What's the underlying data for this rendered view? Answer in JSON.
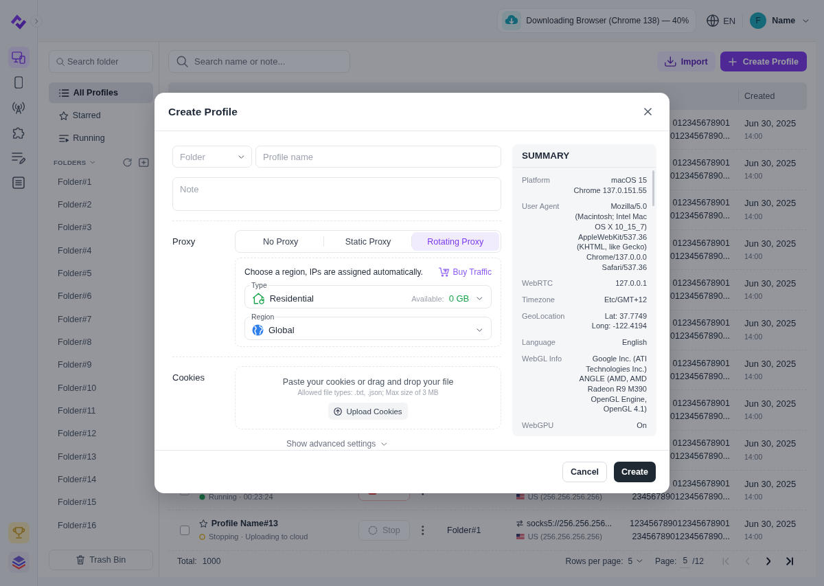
{
  "rail": {
    "items": [
      {
        "selected": true
      },
      {
        "selected": false
      },
      {
        "selected": false
      },
      {
        "selected": false
      },
      {
        "selected": false
      },
      {
        "selected": false
      }
    ]
  },
  "header": {
    "download": {
      "text": "Downloading Browser (Chrome 138) — 40%"
    },
    "language": "EN",
    "user": {
      "initial": "F",
      "name": "Name"
    }
  },
  "folder_panel": {
    "search": {
      "placeholder": "Search folder"
    },
    "views": [
      {
        "label": "All Profiles",
        "selected": true
      },
      {
        "label": "Starred",
        "selected": false
      },
      {
        "label": "Running",
        "selected": false
      }
    ],
    "folders_header": {
      "label": "FOLDERS",
      "expanded": true
    },
    "folders": [
      {
        "label": "Folder#1",
        "selected": false
      },
      {
        "label": "Folder#2",
        "selected": false
      },
      {
        "label": "Folder#3",
        "selected": false
      },
      {
        "label": "Folder#4",
        "selected": false
      },
      {
        "label": "Folder#5",
        "selected": false
      },
      {
        "label": "Folder#6",
        "selected": false
      },
      {
        "label": "Folder#7",
        "selected": false
      },
      {
        "label": "Folder#8",
        "selected": false
      },
      {
        "label": "Folder#9",
        "selected": false
      },
      {
        "label": "Folder#10",
        "selected": false
      },
      {
        "label": "Folder#11",
        "selected": false
      },
      {
        "label": "Folder#12",
        "selected": false
      },
      {
        "label": "Folder#13",
        "selected": false
      },
      {
        "label": "Folder#14",
        "selected": false
      },
      {
        "label": "Folder#15",
        "selected": false
      },
      {
        "label": "Folder#16",
        "selected": false
      }
    ],
    "trash_button": "Trash Bin"
  },
  "toolbar": {
    "search": {
      "placeholder": "Search name or note..."
    },
    "import_button": "Import",
    "create_button": "Create Profile"
  },
  "table": {
    "columns": [
      "Created"
    ],
    "rows": [
      {
        "id_lines": [
          "012345678901",
          "01234567890..."
        ],
        "date": "Jun 30, 2025",
        "time": "14:00"
      },
      {
        "id_lines": [
          "012345678901",
          "01234567890..."
        ],
        "date": "Jun 30, 2025",
        "time": "14:00"
      },
      {
        "id_lines": [
          "012345678901",
          "01234567890..."
        ],
        "date": "Jun 30, 2025",
        "time": "14:00"
      },
      {
        "id_lines": [
          "012345678901",
          "01234567890..."
        ],
        "date": "Jun 30, 2025",
        "time": "14:00"
      },
      {
        "id_lines": [
          "012345678901",
          "01234567890..."
        ],
        "date": "Jun 30, 2025",
        "time": "14:00"
      },
      {
        "id_lines": [
          "012345678901",
          "01234567890..."
        ],
        "date": "Jun 30, 2025",
        "time": "14:00"
      },
      {
        "id_lines": [
          "012345678901",
          "01234567890..."
        ],
        "date": "Jun 30, 2025",
        "time": "14:00"
      },
      {
        "id_lines": [
          "012345678901",
          "01234567890..."
        ],
        "date": "Jun 30, 2025",
        "time": "14:00"
      },
      {
        "id_lines": [
          "012345678901",
          "01234567890..."
        ],
        "date": "Jun 30, 2025",
        "time": "14:00"
      },
      {
        "checked": false,
        "status": {
          "kind": "running",
          "text": "Running · 00:23:24"
        },
        "action": {
          "disabled": false
        },
        "proxy": {
          "location": "US (256.256.256.256)"
        },
        "id_lines": [
          "012345678901",
          "2345678901234567890..."
        ],
        "date": "Jun 30, 2025",
        "time": "14:00"
      },
      {
        "checked": false,
        "starred": false,
        "name": "Profile Name#13",
        "status": {
          "kind": "stopping",
          "text": "Stopping · Uploading to cloud"
        },
        "action": {
          "label": "Stop",
          "disabled": true
        },
        "folder": "Folder#1",
        "proxy": {
          "address": "socks5://256.256.256...",
          "location": "US (256.256.256.256)"
        },
        "id_lines": [
          "123456789012345678901",
          "2345678901234567890..."
        ],
        "date": "Jun 30, 2025",
        "time": "14:00"
      }
    ],
    "footer": {
      "total_label": "Total:",
      "total": "1000",
      "rows_label": "Rows per page:",
      "rows_per_page": "5",
      "page_label": "Page:",
      "page": "5",
      "page_count": "/12",
      "pager": [
        {
          "kind": "first",
          "disabled": true
        },
        {
          "kind": "previous",
          "disabled": true
        },
        {
          "kind": "next",
          "disabled": false
        },
        {
          "kind": "last",
          "disabled": false
        }
      ]
    }
  },
  "modal": {
    "title": "Create Profile",
    "folder_select": {
      "placeholder": "Folder"
    },
    "profile_name": {
      "placeholder": "Profile name"
    },
    "note": {
      "placeholder": "Note"
    },
    "proxy": {
      "label": "Proxy",
      "tabs": [
        {
          "label": "No Proxy",
          "selected": false
        },
        {
          "label": "Static Proxy",
          "selected": false
        },
        {
          "label": "Rotating Proxy",
          "selected": true
        }
      ],
      "hint": "Choose a region, IPs are assigned automatically.",
      "buy_link": "Buy Traffic",
      "type": {
        "label": "Type",
        "value": "Residential",
        "available_label": "Available:",
        "available_value": "0 GB"
      },
      "region": {
        "label": "Region",
        "value": "Global"
      }
    },
    "cookies": {
      "label": "Cookies",
      "drop_text": "Paste your cookies or drag and drop your file",
      "allowed": "Allowed file types: .txt, .json; Max size of 3 MB",
      "upload_button": "Upload Cookies"
    },
    "advanced": {
      "label": "Show advanced settings",
      "expanded": false
    },
    "summary": {
      "title": "SUMMARY",
      "rows": [
        {
          "label": "Platform",
          "lines": [
            "macOS 15",
            "Chrome 137.0.151.55"
          ]
        },
        {
          "label": "User Agent",
          "lines": [
            "Mozilla/5.0",
            "(Macintosh; Intel Mac",
            "OS X 10_15_7)",
            "AppleWebKit/537.36",
            "(KHTML, like Gecko)",
            "Chrome/137.0.0.0",
            "Safari/537.36"
          ]
        },
        {
          "label": "WebRTC",
          "lines": [
            "127.0.0.1"
          ]
        },
        {
          "label": "Timezone",
          "lines": [
            "Etc/GMT+12"
          ]
        },
        {
          "label": "GeoLocation",
          "lines": [
            "Lat: 37.7749",
            "Long: -122.4194"
          ]
        },
        {
          "label": "Language",
          "lines": [
            "English"
          ]
        },
        {
          "label": "WebGL Info",
          "lines": [
            "Google Inc. (ATI",
            "Technologies Inc.)",
            "ANGLE (AMD, AMD",
            "Radeon R9 M390",
            "OpenGL Engine,",
            "OpenGL 4.1)"
          ]
        },
        {
          "label": "WebGPU",
          "lines": [
            "On"
          ]
        }
      ]
    },
    "buttons": {
      "cancel": "Cancel",
      "create": "Create"
    }
  }
}
